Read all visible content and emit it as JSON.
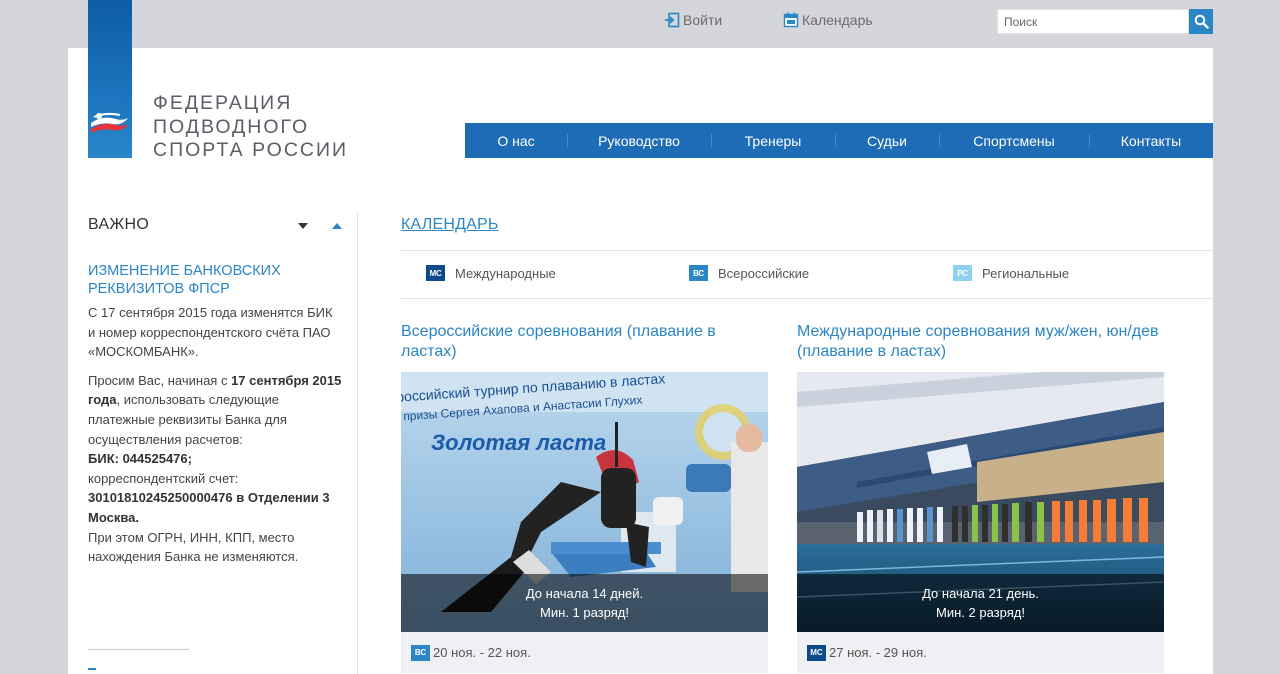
{
  "topbar": {
    "login_label": "Войти",
    "calendar_label": "Календарь",
    "search_placeholder": "Поиск"
  },
  "logo": {
    "line1": "Федерация",
    "line2": "подводного",
    "line3": "спорта России"
  },
  "nav": {
    "items": [
      {
        "label": "О нас"
      },
      {
        "label": "Руководство"
      },
      {
        "label": "Тренеры"
      },
      {
        "label": "Судьи"
      },
      {
        "label": "Спортсмены"
      },
      {
        "label": "Контакты"
      }
    ]
  },
  "sidebar": {
    "title": "Важно",
    "news_title": "Изменение банковских реквизитов ФПСР",
    "p1": "С 17 сентября 2015 года изменятся БИК и номер корреспондентского счёта ПАО «МОСКОМБАНК».",
    "p2_a": "Просим Вас, начиная с ",
    "p2_b": "17 сентября 2015 года",
    "p2_c": ", использовать следующие  платежные реквизиты Банка для осуществления расчетов:",
    "bik": "БИК: 044525476;",
    "corr_label": "корреспондентский счет:",
    "corr_value": "30101810245250000476 в Отделении 3 Москва.",
    "p3": "При этом ОГРН, ИНН, КПП, место нахождения Банка не изменяются."
  },
  "calendar": {
    "heading": "Календарь",
    "filters": [
      {
        "badge": "МС",
        "label": "Международные",
        "color": "#0d4a8b"
      },
      {
        "badge": "ВС",
        "label": "Всероссийские",
        "color": "#2b86c5"
      },
      {
        "badge": "РС",
        "label": "Региональные",
        "color": "#8fd1ef"
      }
    ]
  },
  "events": [
    {
      "title": "Всероссийские соревнования (плавание в ластах)",
      "overlay_line1": "До начала 14 дней.",
      "overlay_line2": "Мин. 1 разряд!",
      "badge": "ВС",
      "dates": "20 ноя. - 22 ноя.",
      "banner_text": "Золотая ласта",
      "banner_caption": "российский турнир по плаванию в ластах",
      "banner_caption2": "призы Сергея Ахапова и Анастасии Глухих"
    },
    {
      "title": "Международные соревнования муж/жен, юн/дев (плавание в ластах)",
      "overlay_line1": "До начала 21 день.",
      "overlay_line2": "Мин. 2 разряд!",
      "badge": "МС",
      "dates": "27 ноя. - 29 ноя."
    }
  ],
  "colors": {
    "accent": "#2b86c5",
    "nav": "#1e6cb5",
    "dark_badge": "#0d4a8b",
    "light_badge": "#8fd1ef"
  }
}
